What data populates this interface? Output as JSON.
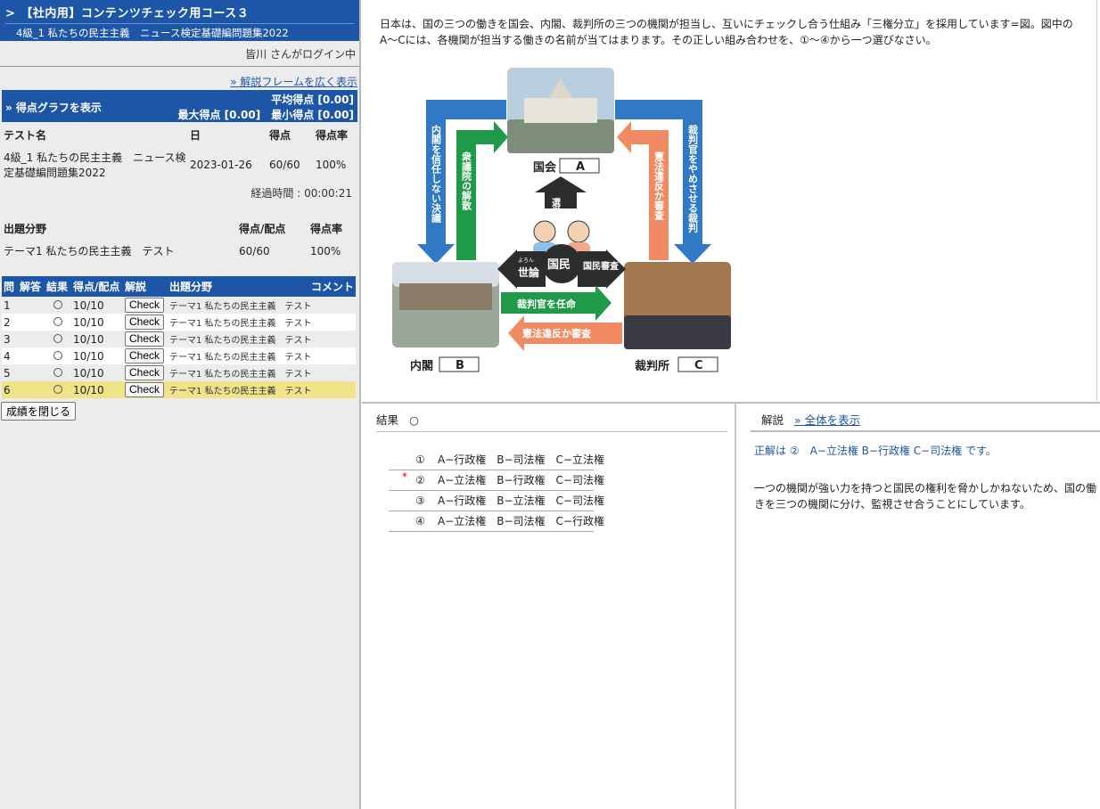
{
  "course": {
    "arrow": ">",
    "title": "【社内用】コンテンツチェック用コース３",
    "subtitle": "4級_1 私たちの民主主義　ニュース検定基礎編問題集2022"
  },
  "login": "皆川 さんがログイン中",
  "wide_link": "» 解説フレームを広く表示",
  "score_graph": {
    "label": "» 得点グラフを表示",
    "avg": "平均得点 [0.00]",
    "max_min": "最大得点 [0.00]　最小得点 [0.00]"
  },
  "summary": {
    "headers": [
      "テスト名",
      "日",
      "得点",
      "得点率"
    ],
    "row": {
      "name": "4級_1 私たちの民主主義　ニュース検定基礎編問題集2022",
      "date": "2023-01-26",
      "score": "60/60",
      "rate": "100%"
    },
    "elapsed": "経過時間 : 00:00:21"
  },
  "field": {
    "headers": [
      "出題分野",
      "得点/配点",
      "得点率"
    ],
    "row": {
      "name": "テーマ1 私たちの民主主義　テスト",
      "score": "60/60",
      "rate": "100%"
    }
  },
  "question_table": {
    "headers": [
      "問",
      "解答",
      "結果",
      "得点/配点",
      "解説",
      "出題分野",
      "コメント"
    ],
    "rows": [
      {
        "no": "1",
        "score": "10/10",
        "button": "Check",
        "field": "テーマ1 私たちの民主主義　テスト"
      },
      {
        "no": "2",
        "score": "10/10",
        "button": "Check",
        "field": "テーマ1 私たちの民主主義　テスト"
      },
      {
        "no": "3",
        "score": "10/10",
        "button": "Check",
        "field": "テーマ1 私たちの民主主義　テスト"
      },
      {
        "no": "4",
        "score": "10/10",
        "button": "Check",
        "field": "テーマ1 私たちの民主主義　テスト"
      },
      {
        "no": "5",
        "score": "10/10",
        "button": "Check",
        "field": "テーマ1 私たちの民主主義　テスト"
      },
      {
        "no": "6",
        "score": "10/10",
        "button": "Check",
        "field": "テーマ1 私たちの民主主義　テスト"
      }
    ],
    "selected_row": "6"
  },
  "close_button": "成績を閉じる",
  "question": {
    "text": "日本は、国の三つの働きを国会、内閣、裁判所の三つの機関が担当し、互いにチェックし合う仕組み「三権分立」を採用しています=図。図中のA〜Cには、各機関が担当する働きの名前が当てはまります。その正しい組み合わせを、①〜④から一つ選びなさい。"
  },
  "figure": {
    "kokkai": "国会",
    "kokkai_box": "A",
    "naikaku": "内閣",
    "naikaku_box": "B",
    "saibansho": "裁判所",
    "saibansho_box": "C",
    "left_outer": "内閣を信任しない決議",
    "left_inner": "衆議院の解散",
    "right_inner": "憲法違反か審査",
    "right_outer": "裁判官をやめさせる裁判",
    "senkyo": "選挙",
    "kokumin": "国民",
    "yoron": "世論",
    "yoron_ruby": "よろん",
    "shinsa": "国民審査",
    "bottom_top": "裁判官を任命",
    "bottom_bottom": "憲法違反か審査",
    "colors": {
      "blue": "#2f79c6",
      "green": "#1e9a49",
      "orange": "#ef8a62",
      "dark": "#2d2d2d"
    }
  },
  "result": {
    "label": "結果",
    "mark": "○",
    "choices": [
      {
        "num": "①",
        "text": "A−行政権　B−司法権　C−立法権"
      },
      {
        "num": "②",
        "text": "A−立法権　B−行政権　C−司法権",
        "star": "*"
      },
      {
        "num": "③",
        "text": "A−行政権　B−立法権　C−司法権"
      },
      {
        "num": "④",
        "text": "A−立法権　B−司法権　C−行政権"
      }
    ]
  },
  "explanation": {
    "label": "解説",
    "link": "» 全体を表示",
    "correct": "正解は ②　A−立法権 B−行政権 C−司法権 です。",
    "body": "一つの機関が強い力を持つと国民の権利を脅かしかねないため、国の働きを三つの機関に分け、監視させ合うことにしています。"
  }
}
